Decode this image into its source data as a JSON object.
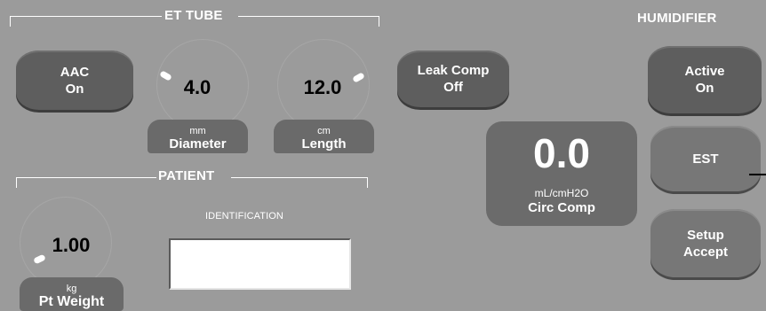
{
  "et_tube": {
    "title": "ET TUBE",
    "aac_button": {
      "line1": "AAC",
      "line2": "On"
    },
    "diameter": {
      "value": "4.0",
      "unit": "mm",
      "label": "Diameter"
    },
    "length": {
      "value": "12.0",
      "unit": "cm",
      "label": "Length"
    }
  },
  "patient": {
    "title": "PATIENT",
    "weight": {
      "value": "1.00",
      "unit": "kg",
      "label": "Pt Weight"
    },
    "identification": {
      "label": "IDENTIFICATION",
      "value": ""
    }
  },
  "leak_comp_button": {
    "line1": "Leak Comp",
    "line2": "Off"
  },
  "circ_comp": {
    "value": "0.0",
    "unit": "mL/cmH2O",
    "label": "Circ Comp"
  },
  "humidifier": {
    "title": "HUMIDIFIER",
    "active_button": {
      "line1": "Active",
      "line2": "On"
    },
    "est_button": {
      "label": "EST"
    },
    "setup_accept_button": {
      "line1": "Setup",
      "line2": "Accept"
    }
  },
  "colors": {
    "background": "#9b9b9b",
    "button_dark": "#5e5e5e",
    "button_mid": "#777777",
    "text_light": "#ffffff",
    "value_text": "#000000"
  }
}
